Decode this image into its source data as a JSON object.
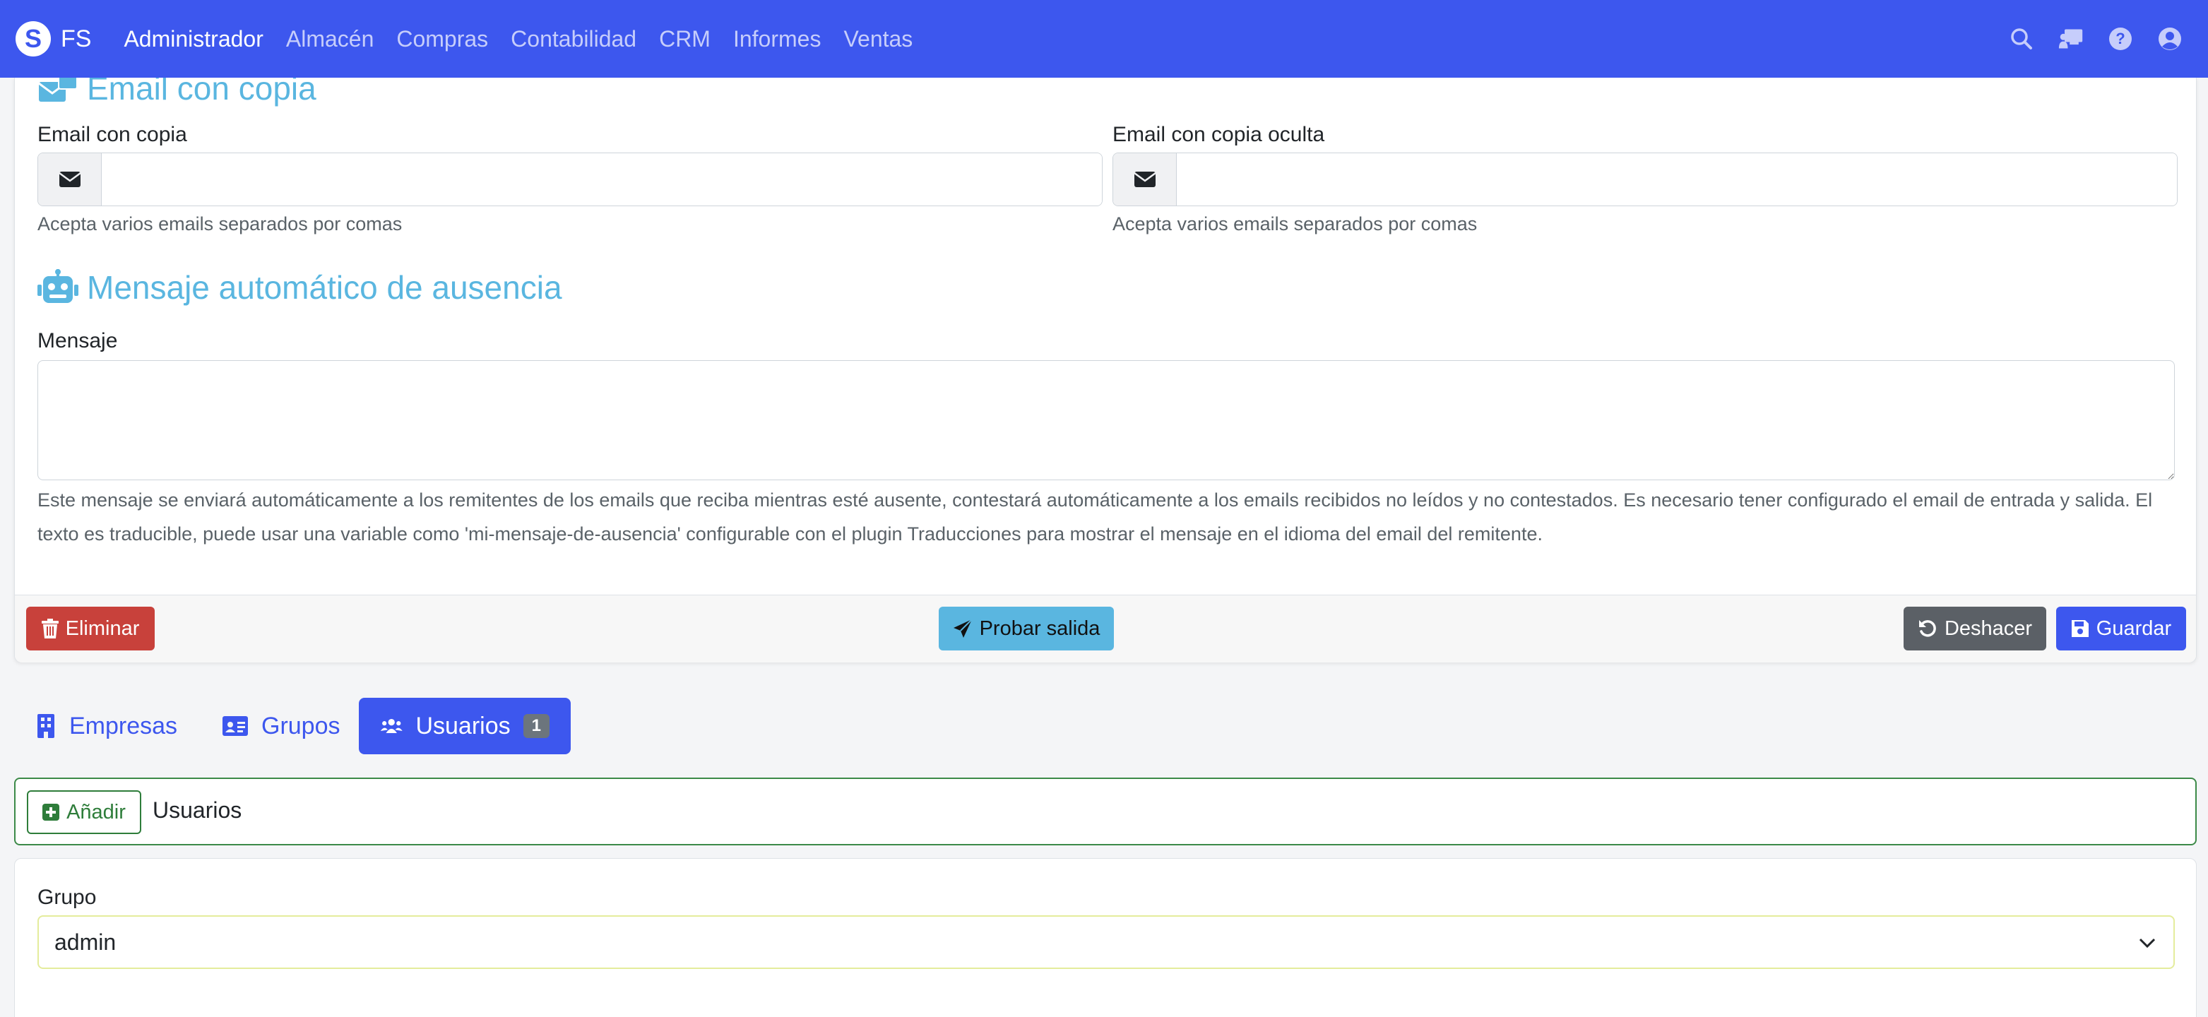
{
  "brand": {
    "logo_letter": "S",
    "text": "FS"
  },
  "nav": {
    "items": [
      {
        "label": "Administrador",
        "active": true
      },
      {
        "label": "Almacén"
      },
      {
        "label": "Compras"
      },
      {
        "label": "Contabilidad"
      },
      {
        "label": "CRM"
      },
      {
        "label": "Informes"
      },
      {
        "label": "Ventas"
      }
    ],
    "icons": [
      "search-icon",
      "chalkboard-user-icon",
      "question-circle-icon",
      "user-circle-icon"
    ]
  },
  "email_copy": {
    "title": "Email con copia",
    "cc_label": "Email con copia",
    "cc_value": "",
    "cc_help": "Acepta varios emails separados por comas",
    "bcc_label": "Email con copia oculta",
    "bcc_value": "",
    "bcc_help": "Acepta varios emails separados por comas"
  },
  "auto_reply": {
    "title": "Mensaje automático de ausencia",
    "message_label": "Mensaje",
    "message_value": "",
    "help": "Este mensaje se enviará automáticamente a los remitentes de los emails que reciba mientras esté ausente, contestará automáticamente a los emails recibidos no leídos y no contestados. Es necesario tener configurado el email de entrada y salida. El texto es traducible, puede usar una variable como 'mi-mensaje-de-ausencia' configurable con el plugin Traducciones para mostrar el mensaje en el idioma del email del remitente."
  },
  "footer": {
    "delete": "Eliminar",
    "test_output": "Probar salida",
    "undo": "Deshacer",
    "save": "Guardar"
  },
  "tabs": [
    {
      "label": "Empresas",
      "icon": "building-icon"
    },
    {
      "label": "Grupos",
      "icon": "id-card-icon"
    },
    {
      "label": "Usuarios",
      "icon": "users-icon",
      "badge": "1",
      "active": true
    }
  ],
  "users_toolbar": {
    "add_label": "Añadir",
    "title": "Usuarios"
  },
  "group": {
    "label": "Grupo",
    "selected": "admin"
  },
  "colors": {
    "navbar": "#3d57ee",
    "section_title": "#5ab6e0",
    "danger": "#c8413b",
    "info": "#5ab6e0",
    "secondary": "#5b6066",
    "primary": "#3d57ee",
    "success": "#2e7d3a"
  }
}
